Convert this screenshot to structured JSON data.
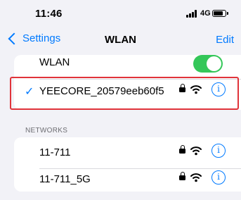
{
  "status_bar": {
    "time": "11:46",
    "network_type": "4G",
    "signal_icon": "cellular-signal-icon",
    "battery_icon": "battery-icon"
  },
  "nav": {
    "back_label": "Settings",
    "title": "WLAN",
    "edit_label": "Edit"
  },
  "wlan_toggle": {
    "label": "WLAN",
    "on": true,
    "color": "#34c759"
  },
  "connected": {
    "check": "✓",
    "name": "YEECORE_20579eeb60f5",
    "secured": true,
    "info": "i"
  },
  "networks": {
    "header": "NETWORKS",
    "items": [
      {
        "name": "11-711",
        "secured": true,
        "info": "i"
      },
      {
        "name": "11-711_5G",
        "secured": true,
        "info": "i"
      }
    ]
  },
  "colors": {
    "accent": "#007aff",
    "highlight": "#e0333a",
    "background": "#f2f2f7"
  }
}
